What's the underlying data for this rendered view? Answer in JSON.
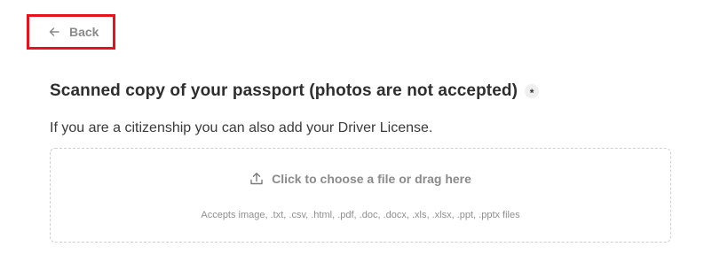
{
  "back": {
    "label": "Back",
    "icon": "arrow-left-icon"
  },
  "field": {
    "title": "Scanned copy of your passport (photos are not accepted)",
    "required_mark": "*",
    "description": "If you are a citizenship you can also add your Driver License."
  },
  "upload": {
    "icon": "upload-icon",
    "cta": "Click to choose a file or drag here",
    "accepts": "Accepts image, .txt, .csv, .html, .pdf, .doc, .docx, .xls, .xlsx, .ppt, .pptx files"
  },
  "colors": {
    "highlight_border": "#e8121c",
    "muted_text": "#8a8a8a",
    "dropzone_border": "#cfcfcf"
  }
}
